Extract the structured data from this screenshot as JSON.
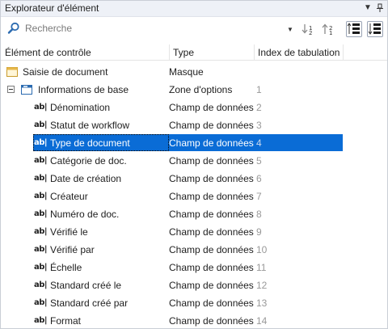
{
  "panel": {
    "title": "Explorateur d'élément",
    "dropdown_icon": "caret-down-icon",
    "pin_icon": "pin-icon"
  },
  "toolbar": {
    "search_placeholder": "Recherche",
    "search_value": "",
    "buttons": [
      "move-down-icon",
      "move-up-icon",
      "expand-all-icon",
      "collapse-all-icon"
    ]
  },
  "columns": {
    "name": "Élément de contrôle",
    "type": "Type",
    "tab_index": "Index de tabulation"
  },
  "rows": [
    {
      "name": "Saisie de document",
      "type": "Masque",
      "tab": ""
    },
    {
      "name": "Informations de base",
      "type": "Zone d'options",
      "tab": "1"
    },
    {
      "name": "Dénomination",
      "type": "Champ de données",
      "tab": "2"
    },
    {
      "name": "Statut de workflow",
      "type": "Champ de données",
      "tab": "3"
    },
    {
      "name": "Type de document",
      "type": "Champ de données",
      "tab": "4"
    },
    {
      "name": "Catégorie de doc.",
      "type": "Champ de données",
      "tab": "5"
    },
    {
      "name": "Date de création",
      "type": "Champ de données",
      "tab": "6"
    },
    {
      "name": "Créateur",
      "type": "Champ de données",
      "tab": "7"
    },
    {
      "name": "Numéro de doc.",
      "type": "Champ de données",
      "tab": "8"
    },
    {
      "name": "Vérifié le",
      "type": "Champ de données",
      "tab": "9"
    },
    {
      "name": "Vérifié par",
      "type": "Champ de données",
      "tab": "10"
    },
    {
      "name": "Échelle",
      "type": "Champ de données",
      "tab": "11"
    },
    {
      "name": "Standard créé le",
      "type": "Champ de données",
      "tab": "12"
    },
    {
      "name": "Standard créé par",
      "type": "Champ de données",
      "tab": "13"
    },
    {
      "name": "Format",
      "type": "Champ de données",
      "tab": "14"
    }
  ],
  "field_glyph": "ab|",
  "colors": {
    "selection": "#0a6cd6",
    "titlebar": "#eef1f7",
    "tab_index_text": "#999999"
  }
}
